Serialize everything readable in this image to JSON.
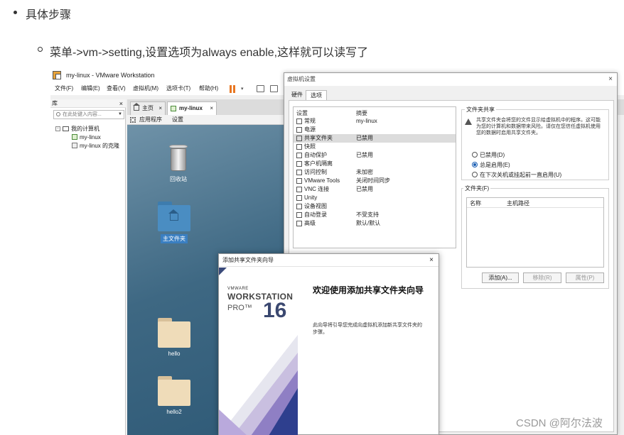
{
  "article": {
    "step_heading": "具体步骤",
    "step_detail": "菜单->vm->setting,设置选项为always enable,这样就可以读写了"
  },
  "vmware": {
    "window_title": "my-linux - VMware Workstation",
    "menu": [
      "文件(F)",
      "编辑(E)",
      "查看(V)",
      "虚拟机(M)",
      "选项卡(T)",
      "帮助(H)"
    ],
    "library": {
      "title": "库",
      "close": "×",
      "search_placeholder": "在此处键入内容...",
      "tree_root": "我的计算机",
      "tree_items": [
        "my-linux",
        "my-linux 的克隆"
      ],
      "expander": "-"
    },
    "tabs": [
      {
        "label": "主页",
        "close": "×"
      },
      {
        "label": "my-linux",
        "close": "×"
      }
    ],
    "guest_topbar": {
      "apps": "应用程序",
      "settings": "设置"
    },
    "desktop_icons": {
      "trash": "回收站",
      "home": "主文件夹",
      "folder1": "hello",
      "folder2": "hello2"
    },
    "settings_dialog": {
      "title": "虚拟机设置",
      "close": "×",
      "tabs": [
        "硬件",
        "选项"
      ],
      "list_headers": {
        "setting": "设置",
        "summary": "摘要"
      },
      "rows": [
        {
          "name": "常规",
          "summary": "my-linux"
        },
        {
          "name": "电源",
          "summary": ""
        },
        {
          "name": "共享文件夹",
          "summary": "已禁用"
        },
        {
          "name": "快照",
          "summary": ""
        },
        {
          "name": "自动保护",
          "summary": "已禁用"
        },
        {
          "name": "客户机隔离",
          "summary": ""
        },
        {
          "name": "访问控制",
          "summary": "未加密"
        },
        {
          "name": "VMware Tools",
          "summary": "关闭时间同步"
        },
        {
          "name": "VNC 连接",
          "summary": "已禁用"
        },
        {
          "name": "Unity",
          "summary": ""
        },
        {
          "name": "设备视图",
          "summary": ""
        },
        {
          "name": "自动登录",
          "summary": "不受支持"
        },
        {
          "name": "高级",
          "summary": "默认/默认"
        }
      ],
      "sharing_group": {
        "title": "文件夹共享",
        "warning": "共享文件夹会将您的文件显示给虚拟机中的程序。这可能为您的计算机和数据带来风险。请仅在您信任虚拟机使用您的数据时启用共享文件夹。",
        "options": [
          "已禁用(D)",
          "总是启用(E)",
          "在下次关机或挂起前一直启用(U)"
        ],
        "selected_index": 1
      },
      "folders_group": {
        "title": "文件夹(F)",
        "columns": [
          "名称",
          "主机路径"
        ],
        "buttons": {
          "add": "添加(A)...",
          "remove": "移除(R)",
          "properties": "属性(P)"
        }
      }
    },
    "wizard": {
      "title": "添加共享文件夹向导",
      "close": "×",
      "brand_vendor": "VMWARE",
      "brand_product": "WORKSTATION",
      "brand_edition": "PRO™",
      "brand_version": "16",
      "heading": "欢迎使用添加共享文件夹向导",
      "description": "此向导将引导您完成向虚拟机添加新共享文件夹的步骤。"
    }
  },
  "watermark": "CSDN @阿尔法波"
}
